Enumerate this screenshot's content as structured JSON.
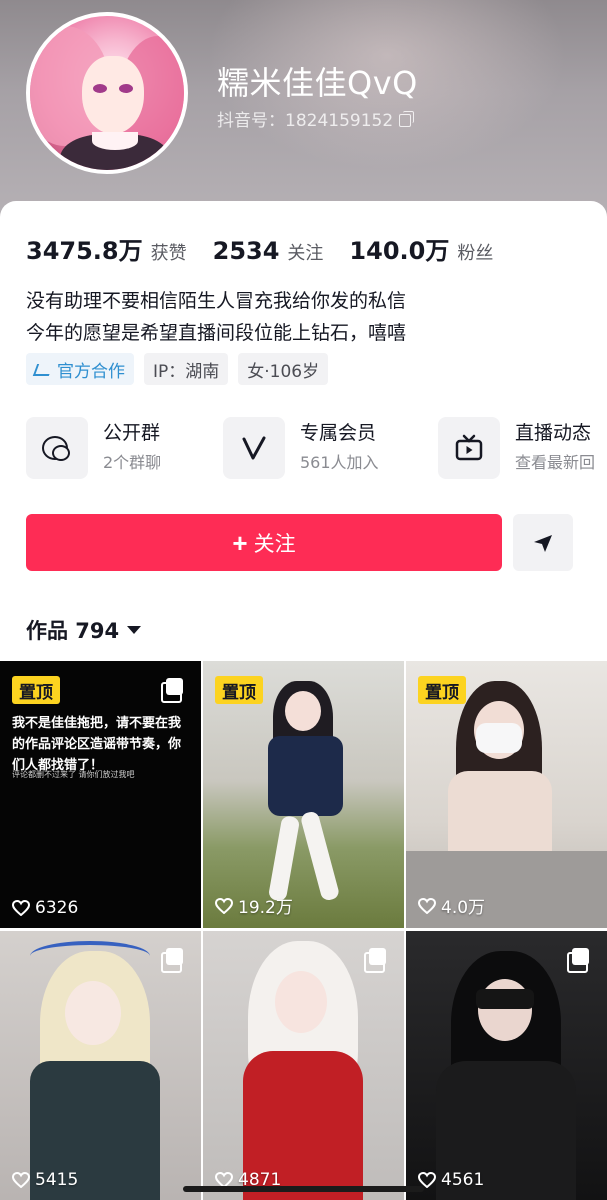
{
  "profile": {
    "nickname": "糯米佳佳QvQ",
    "douyin_id": "抖音号：1824159152"
  },
  "stats": [
    {
      "value": "3475.8万",
      "label": "获赞"
    },
    {
      "value": "2534",
      "label": "关注"
    },
    {
      "value": "140.0万",
      "label": "粉丝"
    }
  ],
  "bio": {
    "line1": "没有助理不要相信陌生人冒充我给你发的私信",
    "line2": "今年的愿望是希望直播间段位能上钻石，嘻嘻"
  },
  "tags": {
    "official": "官方合作",
    "ip": "IP：湖南",
    "gender_age": "女·106岁"
  },
  "features": [
    {
      "title": "公开群",
      "subtitle": "2个群聊",
      "icon": "chat-bubbles-icon"
    },
    {
      "title": "专属会员",
      "subtitle": "561人加入",
      "icon": "v-icon"
    },
    {
      "title": "直播动态",
      "subtitle": "查看最新回",
      "icon": "tv-icon"
    }
  ],
  "actions": {
    "follow_plus": "+",
    "follow_label": "关注"
  },
  "works": {
    "title": "作品 794"
  },
  "grid": [
    {
      "pinned": "置顶",
      "likes": "6326",
      "text": "我不是佳佳拖把，请不要在我的作品评论区造谣带节奏，你们人都找错了！",
      "subtext": "评论都删不过来了 请你们放过我吧"
    },
    {
      "pinned": "置顶",
      "likes": "19.2万"
    },
    {
      "pinned": "置顶",
      "likes": "4.0万"
    },
    {
      "likes": "5415"
    },
    {
      "likes": "4871"
    },
    {
      "likes": "4561"
    }
  ],
  "colors": {
    "accent": "#fe2c55",
    "pin_badge": "#fcd320",
    "official_blue": "#2f8fd0"
  }
}
